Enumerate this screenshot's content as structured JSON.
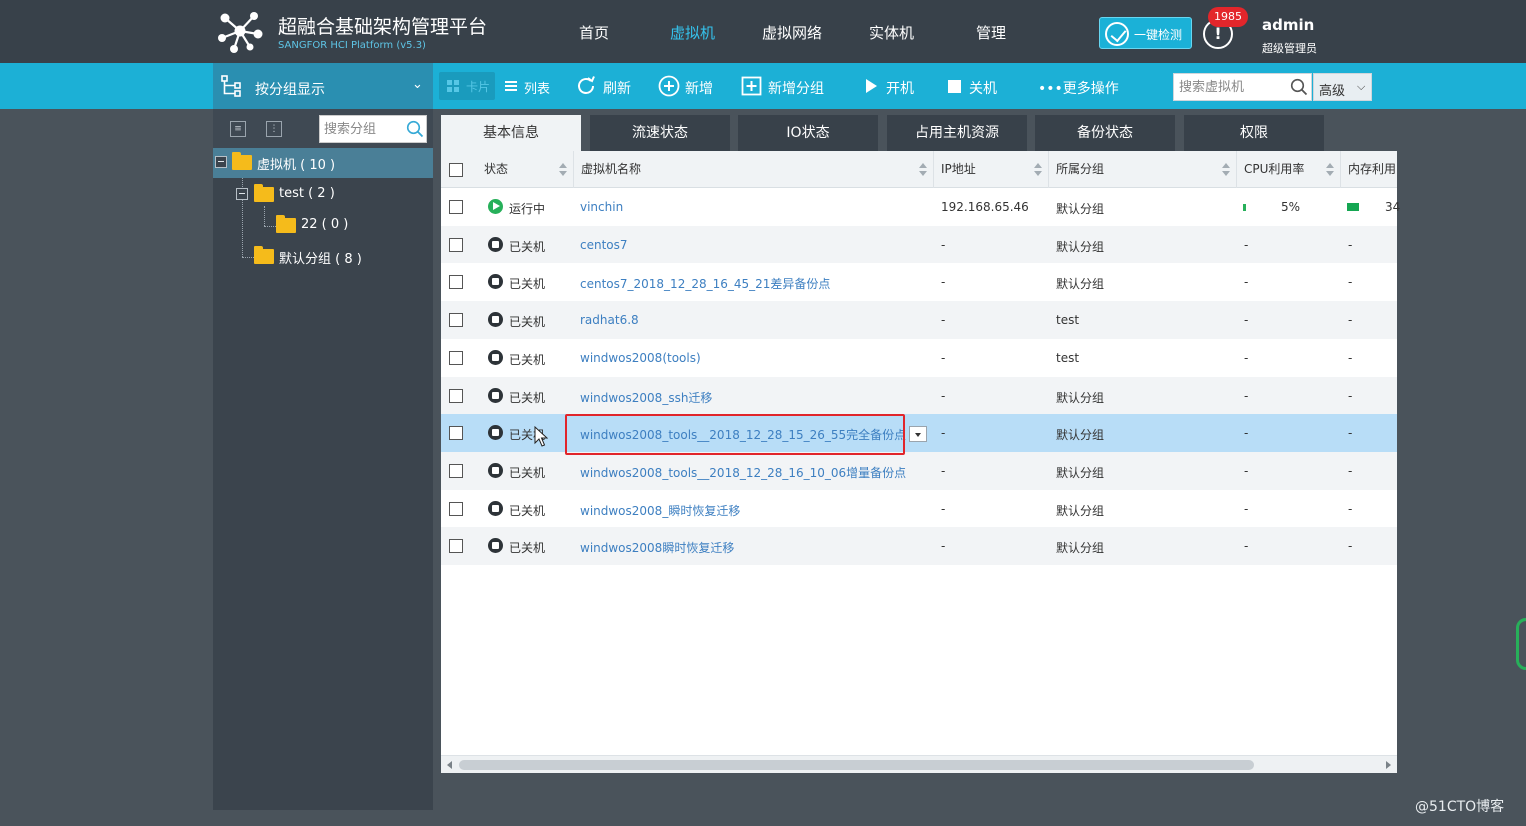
{
  "header": {
    "title": "超融合基础架构管理平台",
    "subtitle": "SANGFOR HCI Platform (v5.3)",
    "nav": [
      "首页",
      "虚拟机",
      "虚拟网络",
      "实体机",
      "管理"
    ],
    "active_nav": "虚拟机",
    "quick_check": "一键检测",
    "alert_icon": "!",
    "alert_count": "1985",
    "user_name": "admin",
    "user_role": "超级管理员"
  },
  "toolbar": {
    "group_display": "按分组显示",
    "view_card": "卡片",
    "view_list": "列表",
    "refresh": "刷新",
    "add": "新增",
    "add_group": "新增分组",
    "power_on": "开机",
    "power_off": "关机",
    "more": "•••更多操作",
    "search_placeholder": "搜索虚拟机",
    "advanced": "高级"
  },
  "sidebar": {
    "search_placeholder": "搜索分组",
    "tree": [
      {
        "label": "虚拟机 ( 10 )",
        "level": 0,
        "selected": true
      },
      {
        "label": "test ( 2 )",
        "level": 1
      },
      {
        "label": "22 ( 0 )",
        "level": 2
      },
      {
        "label": "默认分组 ( 8 )",
        "level": 1
      }
    ]
  },
  "tabs": [
    "基本信息",
    "流速状态",
    "IO状态",
    "占用主机资源",
    "备份状态",
    "权限"
  ],
  "active_tab": "基本信息",
  "table": {
    "headers": {
      "status": "状态",
      "name": "虚拟机名称",
      "ip": "IP地址",
      "group": "所属分组",
      "cpu": "CPU利用率",
      "mem": "内存利用"
    },
    "rows": [
      {
        "status": "运行中",
        "state": "running",
        "name": "vinchin",
        "ip": "192.168.65.46",
        "group": "默认分组",
        "cpu": "5%",
        "mem": "34"
      },
      {
        "status": "已关机",
        "state": "off",
        "name": "centos7",
        "ip": "-",
        "group": "默认分组",
        "cpu": "-",
        "mem": "-"
      },
      {
        "status": "已关机",
        "state": "off",
        "name": "centos7_2018_12_28_16_45_21差异备份点",
        "ip": "-",
        "group": "默认分组",
        "cpu": "-",
        "mem": "-"
      },
      {
        "status": "已关机",
        "state": "off",
        "name": "radhat6.8",
        "ip": "-",
        "group": "test",
        "cpu": "-",
        "mem": "-"
      },
      {
        "status": "已关机",
        "state": "off",
        "name": "windwos2008(tools)",
        "ip": "-",
        "group": "test",
        "cpu": "-",
        "mem": "-"
      },
      {
        "status": "已关机",
        "state": "off",
        "name": "windwos2008_ssh迁移",
        "ip": "-",
        "group": "默认分组",
        "cpu": "-",
        "mem": "-"
      },
      {
        "status": "已关机",
        "state": "off",
        "name": "windwos2008_tools__2018_12_28_15_26_55完全备份点",
        "ip": "-",
        "group": "默认分组",
        "cpu": "-",
        "mem": "-",
        "selected": true
      },
      {
        "status": "已关机",
        "state": "off",
        "name": "windwos2008_tools__2018_12_28_16_10_06增量备份点",
        "ip": "-",
        "group": "默认分组",
        "cpu": "-",
        "mem": "-"
      },
      {
        "status": "已关机",
        "state": "off",
        "name": "windwos2008_瞬时恢复迁移",
        "ip": "-",
        "group": "默认分组",
        "cpu": "-",
        "mem": "-"
      },
      {
        "status": "已关机",
        "state": "off",
        "name": "windwos2008瞬时恢复迁移",
        "ip": "-",
        "group": "默认分组",
        "cpu": "-",
        "mem": "-"
      }
    ]
  },
  "watermark": "@51CTO博客",
  "colors": {
    "header_bg": "#38414a",
    "toolbar_bg": "#1cb0d6",
    "accent": "#35c2ec",
    "running": "#27b05a",
    "highlight": "#e1252b",
    "link": "#3d7fc1"
  }
}
